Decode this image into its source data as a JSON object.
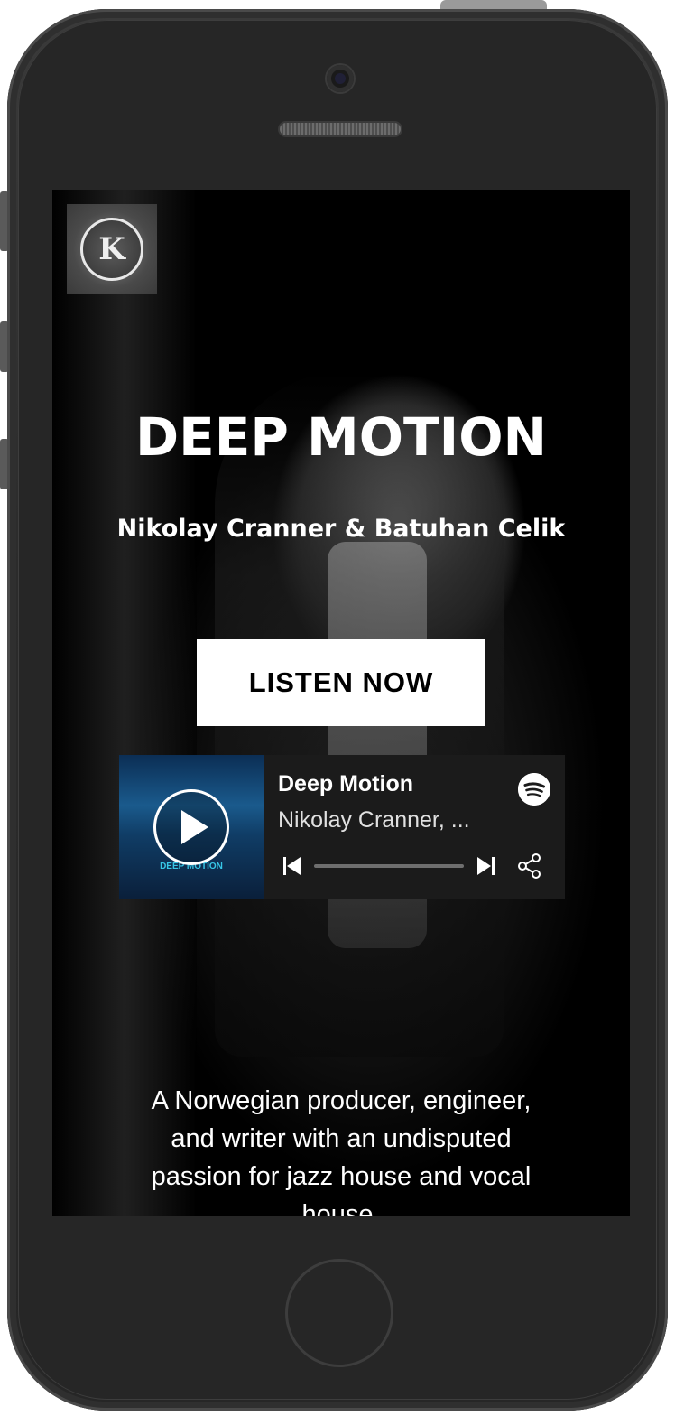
{
  "site": {
    "title": "DEEP MOTION",
    "subtitle": "Nikolay Cranner & Batuhan Celik",
    "cta_label": "LISTEN NOW",
    "description": "A Norwegian producer, engineer, and writer with an undisputed passion for jazz house and vocal house."
  },
  "player": {
    "track_title": "Deep Motion",
    "track_artist": "Nikolay Cranner, ...",
    "cover_text": "DEEP MOTION",
    "progress": 0.0,
    "icons": [
      "play-icon",
      "spotify-icon",
      "skip-back-icon",
      "skip-forward-icon",
      "share-icon"
    ]
  },
  "colors": {
    "screen_bg": "#000000",
    "button_bg": "#ffffff",
    "player_bg": "#1b1b1b",
    "cover_accent": "#36c6e6"
  }
}
